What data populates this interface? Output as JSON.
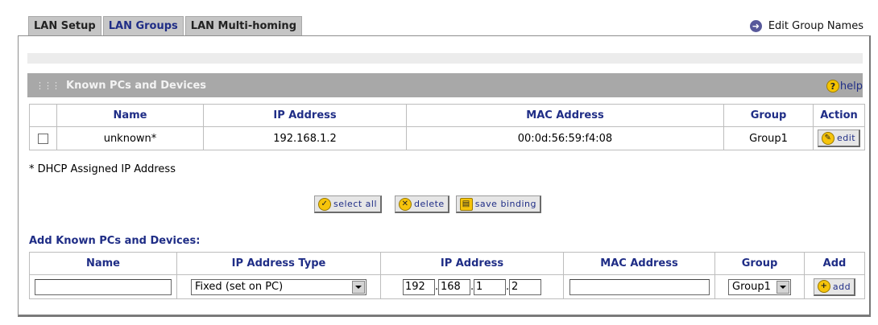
{
  "tabs": [
    {
      "label": "LAN Setup",
      "active": false
    },
    {
      "label": "LAN Groups",
      "active": true
    },
    {
      "label": "LAN Multi-homing",
      "active": false
    }
  ],
  "edit_group_names": "Edit Group Names",
  "section_title": "Known PCs and Devices",
  "help_label": "help",
  "known_table": {
    "headers": [
      "Name",
      "IP Address",
      "MAC Address",
      "Group",
      "Action"
    ],
    "rows": [
      {
        "checked": false,
        "name": "unknown*",
        "ip": "192.168.1.2",
        "mac": "00:0d:56:59:f4:08",
        "group": "Group1",
        "action_label": "edit"
      }
    ]
  },
  "footnote": "* DHCP Assigned IP Address",
  "buttons": {
    "select_all": "select all",
    "delete": "delete",
    "save_binding": "save binding"
  },
  "add_section_title": "Add Known PCs and Devices:",
  "add_table": {
    "headers": [
      "Name",
      "IP Address Type",
      "IP Address",
      "MAC Address",
      "Group",
      "Add"
    ],
    "name_value": "",
    "ip_type_selected": "Fixed (set on PC)",
    "ip_octets": [
      "192",
      "168",
      "1",
      "2"
    ],
    "mac_value": "",
    "group_selected": "Group1",
    "add_label": "add"
  },
  "colors": {
    "accent_text": "#1f2d86",
    "section_bar": "#a8a8a8",
    "tab_bg": "#c5c5c5",
    "button_icon": "#f6c40b"
  }
}
